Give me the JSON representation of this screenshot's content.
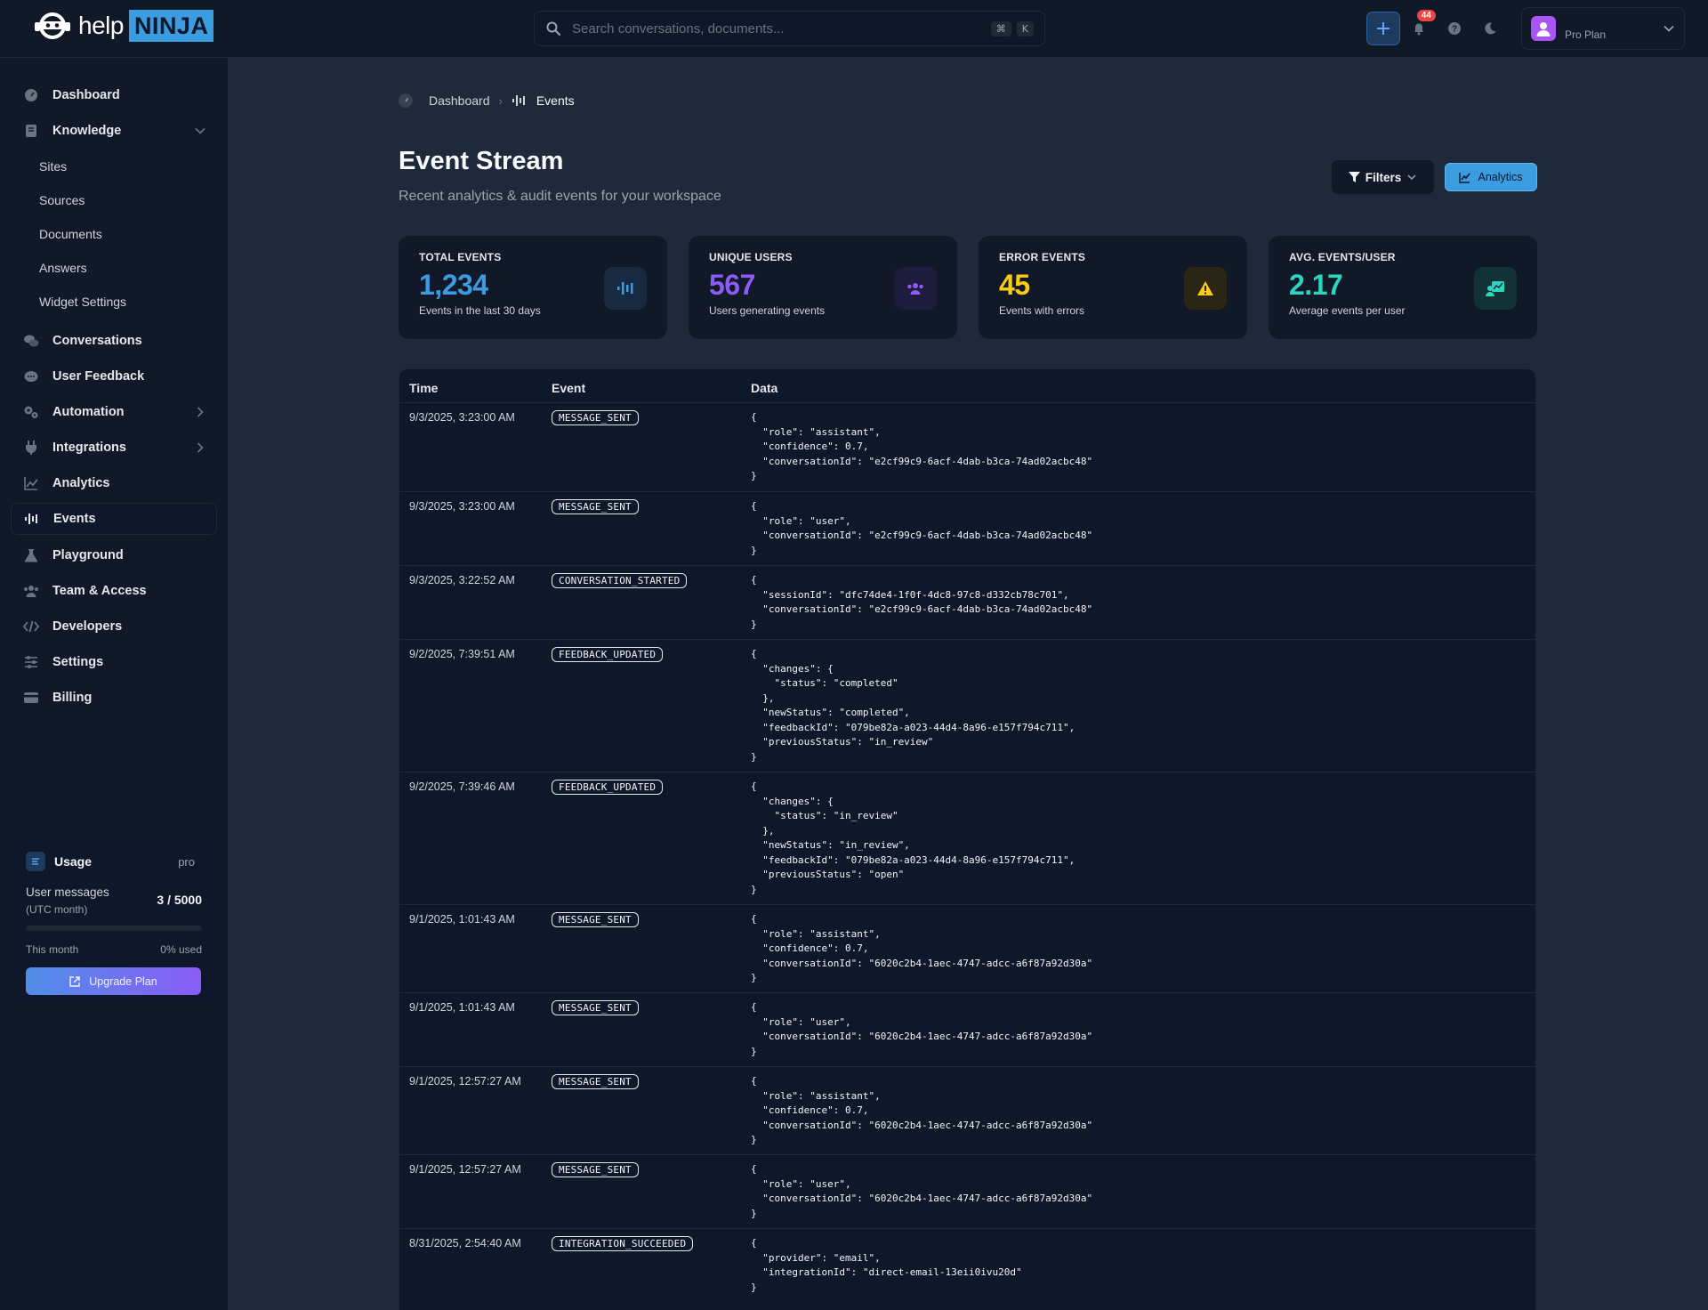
{
  "brand": {
    "help": "help",
    "ninja": "NINJA"
  },
  "search": {
    "placeholder": "Search conversations, documents...",
    "kbd1": "⌘",
    "kbd2": "K"
  },
  "header": {
    "notifications_count": "44",
    "plan": "Pro Plan"
  },
  "sidebar": {
    "items": [
      {
        "label": "Dashboard",
        "icon": "gauge-icon"
      },
      {
        "label": "Knowledge",
        "icon": "book-icon"
      },
      {
        "label": "Conversations",
        "icon": "chat-bubbles-icon"
      },
      {
        "label": "User Feedback",
        "icon": "comment-dots-icon"
      },
      {
        "label": "Automation",
        "icon": "gears-icon"
      },
      {
        "label": "Integrations",
        "icon": "plug-icon"
      },
      {
        "label": "Analytics",
        "icon": "line-chart-icon"
      },
      {
        "label": "Events",
        "icon": "wave-icon"
      },
      {
        "label": "Playground",
        "icon": "flask-icon"
      },
      {
        "label": "Team & Access",
        "icon": "users-icon"
      },
      {
        "label": "Developers",
        "icon": "code-icon"
      },
      {
        "label": "Settings",
        "icon": "sliders-icon"
      },
      {
        "label": "Billing",
        "icon": "credit-card-icon"
      }
    ],
    "knowledge_sub": [
      "Sites",
      "Sources",
      "Documents",
      "Answers",
      "Widget Settings"
    ],
    "usage": {
      "title": "Usage",
      "tier": "pro",
      "messages_label": "User messages",
      "messages_sub": "(UTC month)",
      "count": "3 / 5000",
      "percent_used": 0,
      "period": "This month",
      "used_label": "0% used",
      "upgrade_label": "Upgrade Plan"
    }
  },
  "breadcrumb": {
    "home": "Dashboard",
    "current": "Events"
  },
  "page": {
    "title": "Event Stream",
    "subtitle": "Recent analytics & audit events for your workspace",
    "filters_label": "Filters",
    "analytics_label": "Analytics"
  },
  "stats": [
    {
      "label": "TOTAL EVENTS",
      "value": "1,234",
      "desc": "Events in the last 30 days",
      "color": "#3b9ce0"
    },
    {
      "label": "UNIQUE USERS",
      "value": "567",
      "desc": "Users generating events",
      "color": "#8b5cf6"
    },
    {
      "label": "ERROR EVENTS",
      "value": "45",
      "desc": "Events with errors",
      "color": "#facc15"
    },
    {
      "label": "AVG. EVENTS/USER",
      "value": "2.17",
      "desc": "Average events per user",
      "color": "#2dd4bf"
    }
  ],
  "table": {
    "headers": [
      "Time",
      "Event",
      "Data"
    ],
    "rows": [
      {
        "time": "9/3/2025, 3:23:00 AM",
        "event": "MESSAGE_SENT",
        "data": "{\n  \"role\": \"assistant\",\n  \"confidence\": 0.7,\n  \"conversationId\": \"e2cf99c9-6acf-4dab-b3ca-74ad02acbc48\"\n}"
      },
      {
        "time": "9/3/2025, 3:23:00 AM",
        "event": "MESSAGE_SENT",
        "data": "{\n  \"role\": \"user\",\n  \"conversationId\": \"e2cf99c9-6acf-4dab-b3ca-74ad02acbc48\"\n}"
      },
      {
        "time": "9/3/2025, 3:22:52 AM",
        "event": "CONVERSATION_STARTED",
        "data": "{\n  \"sessionId\": \"dfc74de4-1f0f-4dc8-97c8-d332cb78c701\",\n  \"conversationId\": \"e2cf99c9-6acf-4dab-b3ca-74ad02acbc48\"\n}"
      },
      {
        "time": "9/2/2025, 7:39:51 AM",
        "event": "FEEDBACK_UPDATED",
        "data": "{\n  \"changes\": {\n    \"status\": \"completed\"\n  },\n  \"newStatus\": \"completed\",\n  \"feedbackId\": \"079be82a-a023-44d4-8a96-e157f794c711\",\n  \"previousStatus\": \"in_review\"\n}"
      },
      {
        "time": "9/2/2025, 7:39:46 AM",
        "event": "FEEDBACK_UPDATED",
        "data": "{\n  \"changes\": {\n    \"status\": \"in_review\"\n  },\n  \"newStatus\": \"in_review\",\n  \"feedbackId\": \"079be82a-a023-44d4-8a96-e157f794c711\",\n  \"previousStatus\": \"open\"\n}"
      },
      {
        "time": "9/1/2025, 1:01:43 AM",
        "event": "MESSAGE_SENT",
        "data": "{\n  \"role\": \"assistant\",\n  \"confidence\": 0.7,\n  \"conversationId\": \"6020c2b4-1aec-4747-adcc-a6f87a92d30a\"\n}"
      },
      {
        "time": "9/1/2025, 1:01:43 AM",
        "event": "MESSAGE_SENT",
        "data": "{\n  \"role\": \"user\",\n  \"conversationId\": \"6020c2b4-1aec-4747-adcc-a6f87a92d30a\"\n}"
      },
      {
        "time": "9/1/2025, 12:57:27 AM",
        "event": "MESSAGE_SENT",
        "data": "{\n  \"role\": \"assistant\",\n  \"confidence\": 0.7,\n  \"conversationId\": \"6020c2b4-1aec-4747-adcc-a6f87a92d30a\"\n}"
      },
      {
        "time": "9/1/2025, 12:57:27 AM",
        "event": "MESSAGE_SENT",
        "data": "{\n  \"role\": \"user\",\n  \"conversationId\": \"6020c2b4-1aec-4747-adcc-a6f87a92d30a\"\n}"
      },
      {
        "time": "8/31/2025, 2:54:40 AM",
        "event": "INTEGRATION_SUCCEEDED",
        "data": "{\n  \"provider\": \"email\",\n  \"integrationId\": \"direct-email-13eii0ivu20d\"\n}"
      }
    ]
  }
}
